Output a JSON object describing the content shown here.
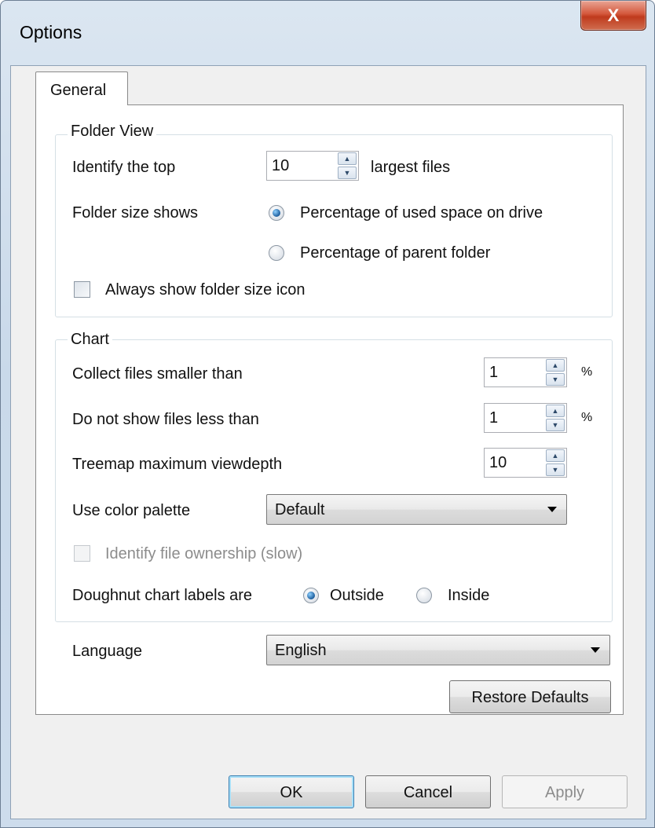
{
  "window": {
    "title": "Options",
    "close_glyph": "X"
  },
  "tabs": [
    {
      "label": "General"
    }
  ],
  "folder_view": {
    "legend": "Folder View",
    "identify_label": "Identify the top",
    "identify_value": "10",
    "identify_suffix": "largest files",
    "folder_size_label": "Folder size shows",
    "options": [
      {
        "label": "Percentage of used space on drive",
        "checked": true
      },
      {
        "label": "Percentage of parent folder",
        "checked": false
      }
    ],
    "always_show_icon_label": "Always show folder size icon",
    "always_show_icon_checked": false
  },
  "chart": {
    "legend": "Chart",
    "collect_label": "Collect files smaller than",
    "collect_value": "1",
    "collect_unit": "%",
    "hide_label": "Do not show files less than",
    "hide_value": "1",
    "hide_unit": "%",
    "depth_label": "Treemap maximum viewdepth",
    "depth_value": "10",
    "palette_label": "Use color palette",
    "palette_value": "Default",
    "ownership_label": "Identify file ownership (slow)",
    "ownership_checked": false,
    "doughnut_label": "Doughnut chart labels are",
    "doughnut_options": [
      {
        "label": "Outside",
        "checked": true
      },
      {
        "label": "Inside",
        "checked": false
      }
    ]
  },
  "language": {
    "label": "Language",
    "value": "English"
  },
  "buttons": {
    "restore": "Restore Defaults",
    "ok": "OK",
    "cancel": "Cancel",
    "apply": "Apply"
  },
  "icons": {
    "spin_up": "▲",
    "spin_down": "▼"
  },
  "colors": {
    "close_button": "#c7452a",
    "radio_dot": "#1c5d9c",
    "default_button_border": "#3c7fb1"
  }
}
